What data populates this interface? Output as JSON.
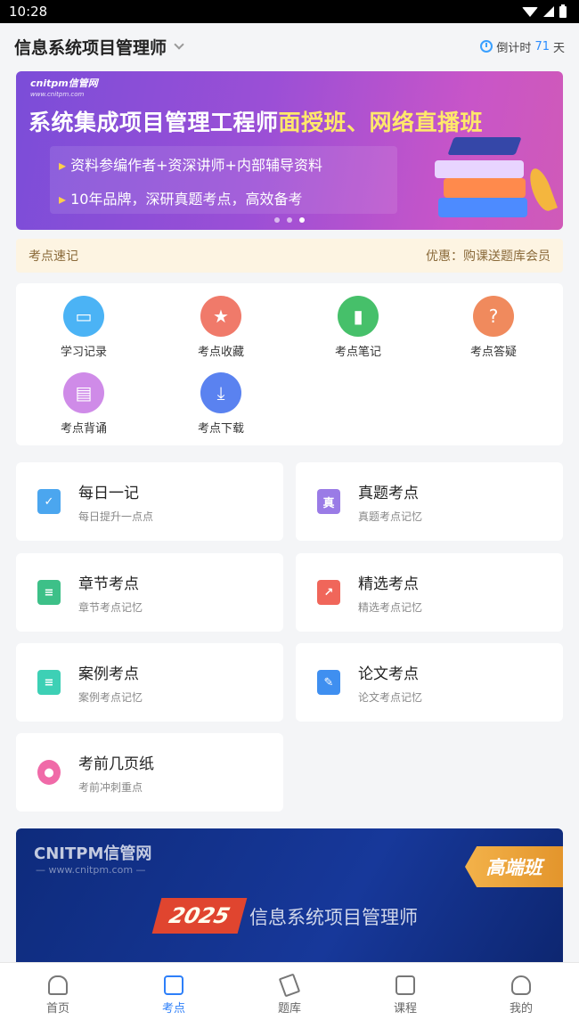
{
  "status": {
    "time": "10:28"
  },
  "header": {
    "exam_title": "信息系统项目管理师",
    "countdown_prefix": "倒计时",
    "countdown_days": "71",
    "countdown_suffix": "天"
  },
  "banner": {
    "logo_brand": "cnitpm信管网",
    "logo_url": "www.cnitpm.com",
    "headline_main": "系统集成项目管理工程师",
    "headline_highlight": "面授班、网络直播班",
    "bullet1": "资料参编作者+资深讲师+内部辅导资料",
    "bullet2": "10年品牌，深研真题考点，高效备考",
    "slide_count": 3,
    "active_slide": 2
  },
  "notice": {
    "left_label": "考点速记",
    "right_label": "优惠：购课送题库会员"
  },
  "grid_items": [
    {
      "label": "学习记录",
      "icon": "study-record-icon",
      "color": "#4bb3f5"
    },
    {
      "label": "考点收藏",
      "icon": "star-icon",
      "color": "#f07a6a"
    },
    {
      "label": "考点笔记",
      "icon": "notebook-icon",
      "color": "#46c06a"
    },
    {
      "label": "考点答疑",
      "icon": "question-icon",
      "color": "#f08a5d"
    },
    {
      "label": "考点背诵",
      "icon": "recite-icon",
      "color": "#cf8be8"
    },
    {
      "label": "考点下载",
      "icon": "download-icon",
      "color": "#5a82f0"
    }
  ],
  "list_cards": [
    {
      "title": "每日一记",
      "subtitle": "每日提升一点点",
      "icon": "bookmark-check-icon",
      "color": "#4ba6ef",
      "glyph": "✓"
    },
    {
      "title": "真题考点",
      "subtitle": "真题考点记忆",
      "icon": "exam-paper-icon",
      "color": "#9a7be6",
      "glyph": "真"
    },
    {
      "title": "章节考点",
      "subtitle": "章节考点记忆",
      "icon": "chapter-icon",
      "color": "#3dc088",
      "glyph": "≡"
    },
    {
      "title": "精选考点",
      "subtitle": "精选考点记忆",
      "icon": "trend-chart-icon",
      "color": "#f0665a",
      "glyph": "↗"
    },
    {
      "title": "案例考点",
      "subtitle": "案例考点记忆",
      "icon": "clipboard-icon",
      "color": "#3dd0b5",
      "glyph": "≡"
    },
    {
      "title": "论文考点",
      "subtitle": "论文考点记忆",
      "icon": "document-edit-icon",
      "color": "#3f8ff0",
      "glyph": "✎"
    },
    {
      "title": "考前几页纸",
      "subtitle": "考前冲刺重点",
      "icon": "lightbulb-icon",
      "color": "#f06aa8",
      "glyph": "●"
    }
  ],
  "banner2": {
    "logo": "CNITPM信管网",
    "url": "— www.cnitpm.com —",
    "tag": "高端班",
    "year": "2025",
    "title": "信息系统项目管理师"
  },
  "tabs": [
    {
      "label": "首页",
      "icon": "home-icon",
      "active": false
    },
    {
      "label": "考点",
      "icon": "checklist-icon",
      "active": true
    },
    {
      "label": "题库",
      "icon": "pencil-icon",
      "active": false
    },
    {
      "label": "课程",
      "icon": "book-icon",
      "active": false
    },
    {
      "label": "我的",
      "icon": "user-icon",
      "active": false
    }
  ]
}
